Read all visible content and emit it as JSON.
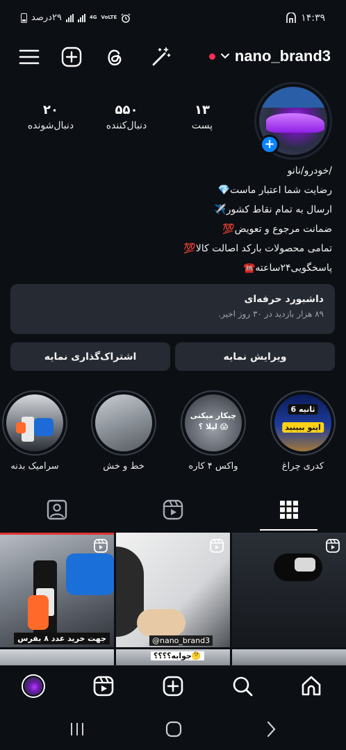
{
  "status_bar": {
    "battery_text": "۲۹درصد",
    "network_label": "4G",
    "volte_label": "VoLTE",
    "time": "۱۴:۳۹"
  },
  "header": {
    "username": "nano_brand3",
    "icons": [
      "menu-icon",
      "add-icon",
      "threads-icon",
      "magic-wand-icon",
      "chevron-down-icon"
    ]
  },
  "profile": {
    "stats": [
      {
        "number": "۱۳",
        "label": "پست"
      },
      {
        "number": "۵۵۰",
        "label": "دنبال‌کننده"
      },
      {
        "number": "۲۰",
        "label": "دنبال‌شونده"
      }
    ],
    "bio_lines": [
      "/خودرو/نانو",
      "رضایت شما اعتبار ماست💎",
      "ارسال به تمام نقاط کشور✈️",
      "ضمانت مرجوع و تعویض💯",
      "تمامی محصولات بارکد اصالت کالا💯",
      "پاسخگویی۲۴ساعته☎️"
    ]
  },
  "dashboard": {
    "title": "داشبورد حرفه‌ای",
    "subtitle": "۸۹ هزار بازدید در ۳۰ روز اخیر."
  },
  "buttons": {
    "edit": "ویرایش نمایه",
    "share": "اشتراک‌گذاری نمایه"
  },
  "highlights": [
    {
      "label": "کدری چراغ",
      "caption_top": "6 ثانیه",
      "caption_bottom": "اینو ببینید"
    },
    {
      "label": "واکس ۴ کاره",
      "caption_top": "چیکار میکنی",
      "caption_bottom": "لیلا ؟ 😱"
    },
    {
      "label": "خط و خش"
    },
    {
      "label": "سرامیک بدنه"
    }
  ],
  "grid": [
    {
      "caption": "جهت خرید عدد ۸ بفرس"
    },
    {
      "caption": "@nano_brand3"
    },
    {
      "caption": ""
    },
    {
      "caption": ""
    },
    {
      "caption": "جوابه؟؟؟؟🤔"
    },
    {
      "caption": ""
    }
  ],
  "colors": {
    "background": "#0c0f14",
    "surface": "#262a33",
    "accent": "#0a84ff",
    "live_dot": "#ff2d55"
  }
}
